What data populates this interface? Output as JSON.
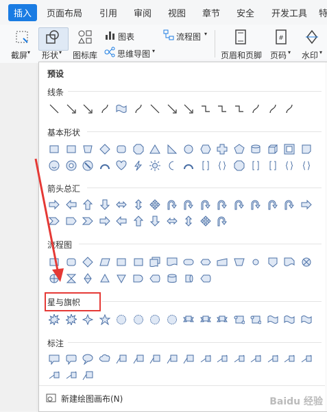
{
  "tabs": {
    "items": [
      "插入",
      "页面布局",
      "引用",
      "审阅",
      "视图",
      "章节",
      "安全",
      "开发工具",
      "特"
    ]
  },
  "ribbon": {
    "screenshot": "截屏",
    "shapes": "形状",
    "icon_library": "图标库",
    "chart": "图表",
    "flowchart": "流程图",
    "mindmap": "思维导图",
    "header_footer": "页眉和页脚",
    "page_number": "页码",
    "watermark": "水印"
  },
  "panel": {
    "preset": "预设",
    "sections": [
      "线条",
      "基本形状",
      "箭头总汇",
      "流程图",
      "星与旗帜",
      "标注"
    ],
    "new_canvas": "新建绘图画布(N)"
  },
  "colors": {
    "accent": "#1a7ce3",
    "highlight": "#e53935",
    "shape_stroke": "#4a6fa5",
    "shape_fill": "#dfe8f5"
  },
  "watermark": "Baidu 经验"
}
